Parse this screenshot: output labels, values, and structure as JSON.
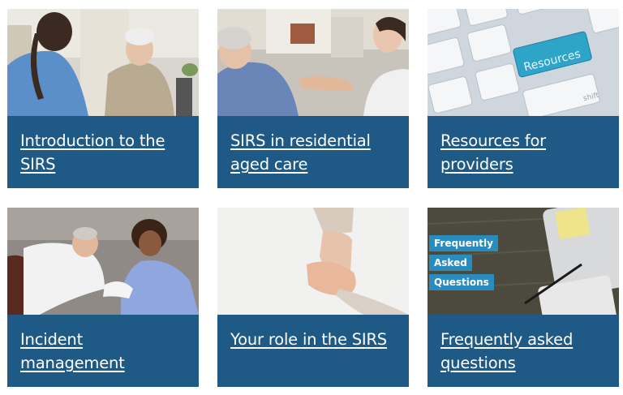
{
  "cards": [
    {
      "title": "Introduction to the SIRS",
      "image": "nurse-with-elderly-woman"
    },
    {
      "title": "SIRS in residential aged care",
      "image": "carer-holding-hands-with-elderly-woman"
    },
    {
      "title": "Resources for providers",
      "image": "keyboard-resources-key",
      "key_label": "Resources",
      "key_sublabel": "shift"
    },
    {
      "title": "Incident management",
      "image": "carer-assisting-elderly-man"
    },
    {
      "title": "Your role in the SIRS",
      "image": "holding-hands"
    },
    {
      "title": "Frequently asked questions",
      "image": "faq-desk",
      "tags": [
        "Frequently",
        "Asked",
        "Questions"
      ]
    }
  ],
  "colors": {
    "panel": "#1e5a85",
    "text": "#ffffff",
    "faq_tag": "#2a8bbf"
  }
}
